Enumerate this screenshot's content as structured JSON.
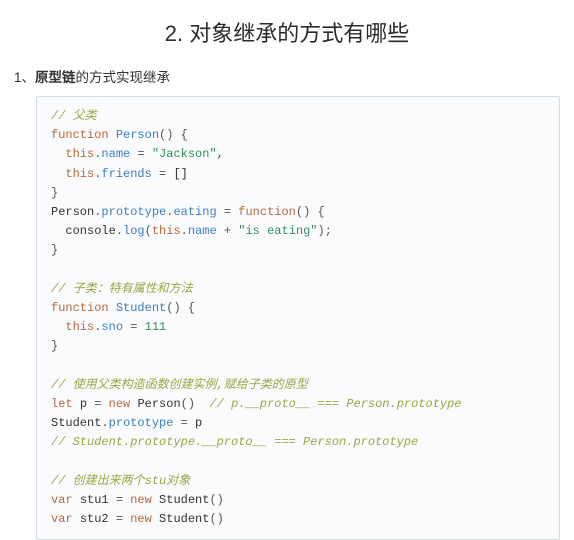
{
  "heading": "2. 对象继承的方式有哪些",
  "sub": {
    "prefix": "1、",
    "bold": "原型链",
    "suffix": "的方式实现继承"
  },
  "code": {
    "c_parent": "// 父类",
    "kw_function1": "function",
    "fn_person": "Person",
    "lparen": "(",
    "rparen": ")",
    "lbrace": "{",
    "rbrace": "}",
    "this": "this",
    "dot": ".",
    "name_prop": "name",
    "eq": " = ",
    "name_val": "\"Jackson\"",
    "comma": ",",
    "friends_prop": "friends",
    "arr_empty": "[]",
    "person_id": "Person",
    "prototype": "prototype",
    "eating": "eating",
    "kw_function2": "function",
    "console": "console",
    "log": "log",
    "plus": " + ",
    "eating_str": "\"is eating\"",
    "semi": ";",
    "c_child": "// 子类：特有属性和方法",
    "kw_function3": "function",
    "fn_student": "Student",
    "sno_prop": "sno",
    "sno_val": "111",
    "c_instance": "// 使用父类构造函数创建实例,赋给子类的原型",
    "kw_let": "let",
    "p_var": "p",
    "kw_new": "new",
    "c_proto_eq": "// p.__proto__ === Person.prototype",
    "student_id": "Student",
    "c_student_proto": "// Student.prototype.__proto__ === Person.prototype",
    "c_create_two": "// 创建出来两个stu对象",
    "kw_var1": "var",
    "stu1": "stu1",
    "kw_var2": "var",
    "stu2": "stu2"
  }
}
